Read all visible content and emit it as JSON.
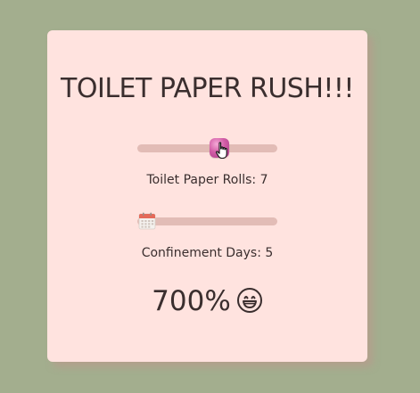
{
  "app": {
    "title": "TOILET PAPER RUSH!!!"
  },
  "rolls_slider": {
    "label": "Toilet Paper Rolls: 7",
    "value": 7,
    "fill_fraction": 0.6,
    "thumb_icon": "toilet-paper-icon"
  },
  "days_slider": {
    "label": "Confinement Days: 5",
    "value": 5,
    "fill_fraction": 0.0,
    "thumb_icon": "calendar-icon"
  },
  "result": {
    "percent": "700%",
    "emoji_icon": "grinning-face-icon"
  },
  "colors": {
    "background": "#a3ae8e",
    "card": "#ffe3df",
    "track": "#e2bcb6",
    "text": "#3a2e2e",
    "roll_thumb": "#d25ca6"
  }
}
